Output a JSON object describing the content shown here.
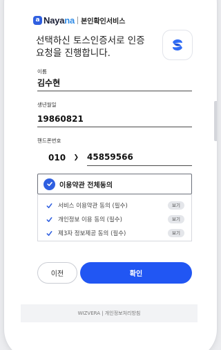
{
  "header": {
    "logo_badge": "a",
    "logo_text_main": "Naya",
    "logo_text_accent": "na",
    "service_title": "본인확인서비스"
  },
  "headline": "선택하신 토스인증서로 인증요청을 진행합니다.",
  "toss_icon": {
    "icon": "toss-logo-icon",
    "color": "#2f6cf6"
  },
  "name": {
    "label": "이름",
    "value": "김수현"
  },
  "birth": {
    "label": "생년월일",
    "value": "19860821"
  },
  "phone": {
    "label": "핸드폰번호",
    "carrier": "010",
    "number": "45859566"
  },
  "agreements": {
    "all_label": "이용약관 전체동의",
    "items": [
      {
        "label": "서비스 이용약관 동의 (필수)",
        "view": "보기"
      },
      {
        "label": "개인정보 이용 동의 (필수)",
        "view": "보기"
      },
      {
        "label": "제3자 정보제공 동의 (필수)",
        "view": "보기"
      }
    ]
  },
  "buttons": {
    "prev": "이전",
    "confirm": "확인"
  },
  "footer": "WIZVERA | 개인정보처리방침",
  "colors": {
    "primary": "#2156f3",
    "brand": "#2f5fe0",
    "accent": "#2f8be6"
  }
}
